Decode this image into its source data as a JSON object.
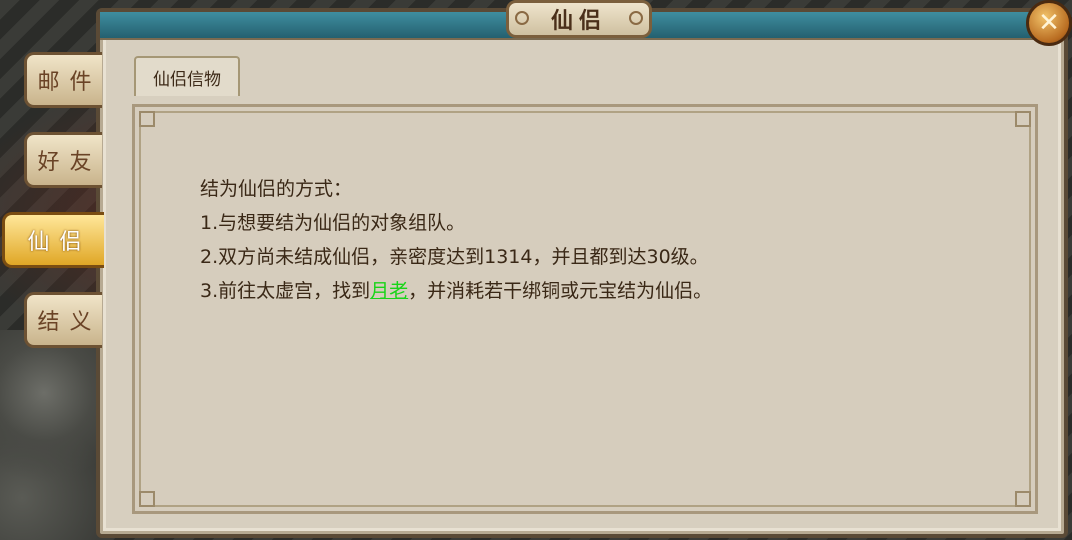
{
  "window": {
    "title": "仙侣"
  },
  "close_icon": "close-icon",
  "side_tabs": [
    {
      "label": "邮件",
      "active": false
    },
    {
      "label": "好友",
      "active": false
    },
    {
      "label": "仙侣",
      "active": true
    },
    {
      "label": "结义",
      "active": false
    }
  ],
  "inner_tab": {
    "label": "仙侣信物"
  },
  "content": {
    "heading": "结为仙侣的方式：",
    "line1": "1.与想要结为仙侣的对象组队。",
    "line2": "2.双方尚未结成仙侣，亲密度达到1314，并且都到达30级。",
    "line3_prefix": "3.前往太虚宫，找到",
    "line3_link": "月老",
    "line3_suffix": "，并消耗若干绑铜或元宝结为仙侣。"
  },
  "colors": {
    "link": "#18d418",
    "active_tab": "#e0a726",
    "title_bar": "#3f8ea0"
  }
}
